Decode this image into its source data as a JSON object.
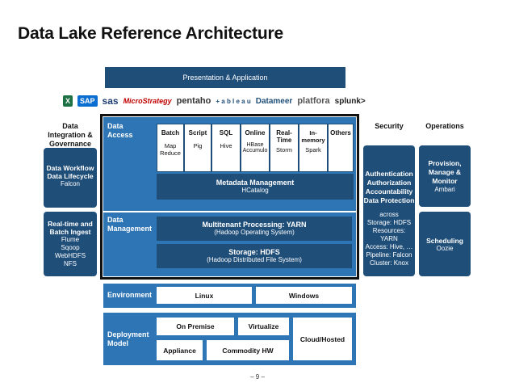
{
  "title": "Data Lake Reference Architecture",
  "presentation": "Presentation & Application",
  "logos": [
    "SAP",
    "sas",
    "MicroStrategy",
    "pentaho",
    "+ a b l e a u",
    "Datameer",
    "platfora",
    "splunk>"
  ],
  "left": {
    "header": "Data Integration & Governance",
    "box1_title": "Data Workflow Data Lifecycle",
    "box1_sub": "Falcon",
    "box2_title": "Real-time and Batch Ingest",
    "box2_items": [
      "Flume",
      "Sqoop",
      "WebHDFS",
      "NFS"
    ]
  },
  "access": {
    "label": "Data Access",
    "columns": [
      {
        "title": "Batch",
        "sub": "Map Reduce"
      },
      {
        "title": "Script",
        "sub": "Pig"
      },
      {
        "title": "SQL",
        "sub": "Hive"
      },
      {
        "title": "Online",
        "sub": "HBase Accumulo"
      },
      {
        "title": "Real-Time",
        "sub": "Storm"
      },
      {
        "title": "In-memory",
        "sub": "Spark"
      },
      {
        "title": "Others",
        "sub": ""
      }
    ],
    "metadata_title": "Metadata Management",
    "metadata_sub": "HCatalog"
  },
  "management": {
    "label": "Data Management",
    "yarn_title": "Multitenant Processing: YARN",
    "yarn_sub": "(Hadoop Operating System)",
    "hdfs_title": "Storage: HDFS",
    "hdfs_sub": "(Hadoop Distributed File System)"
  },
  "environment": {
    "label": "Environment",
    "linux": "Linux",
    "windows": "Windows"
  },
  "deployment": {
    "label": "Deployment Model",
    "on_premise": "On Premise",
    "virtualize": "Virtualize",
    "appliance": "Appliance",
    "commodity": "Commodity HW",
    "cloud": "Cloud/Hosted"
  },
  "security": {
    "header": "Security",
    "title": "Authentication Authorization Accountability Data Protection",
    "across": "across",
    "items": [
      "Storage: HDFS",
      "Resources: YARN",
      "Access: Hive, …",
      "Pipeline: Falcon",
      "Cluster: Knox"
    ]
  },
  "operations": {
    "header": "Operations",
    "box1_title": "Provision, Manage & Monitor",
    "box1_sub": "Ambari",
    "box2_title": "Scheduling",
    "box2_sub": "Oozie"
  },
  "page_number": "– 9 –",
  "colors": {
    "dark_blue": "#1f4e79",
    "mid_blue": "#2e75b6"
  }
}
